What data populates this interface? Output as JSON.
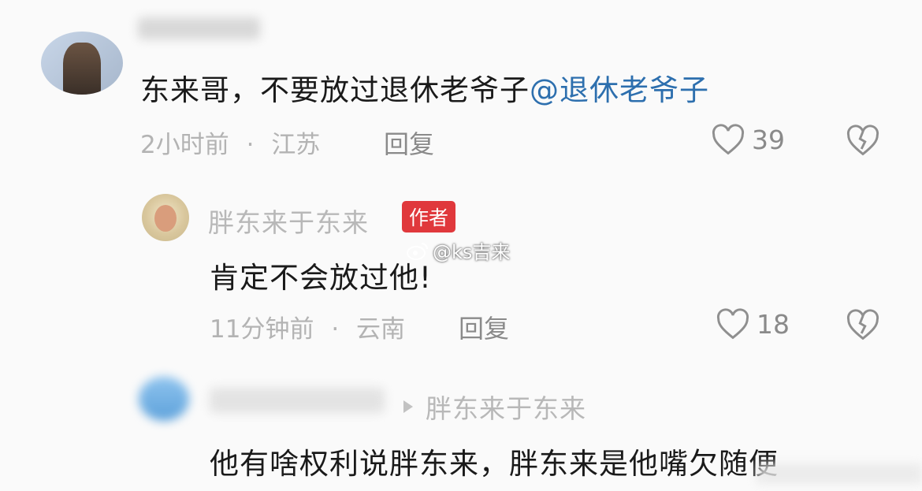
{
  "comments": [
    {
      "text": "东来哥，不要放过退休老爷子",
      "mention": "@退休老爷子",
      "time": "2小时前",
      "location": "江苏",
      "reply_label": "回复",
      "likes": "39"
    },
    {
      "author": "胖东来于东来",
      "badge": "作者",
      "text": "肯定不会放过他!",
      "time": "11分钟前",
      "location": "云南",
      "reply_label": "回复",
      "likes": "18"
    },
    {
      "reply_to": "胖东来于东来",
      "text": "他有啥权利说胖东来，胖东来是他嘴欠随便"
    }
  ],
  "watermark": "@ks吉来",
  "separator": "·",
  "colors": {
    "mention": "#2d6fae",
    "badge": "#e0383c",
    "muted": "#b3b3b3"
  }
}
